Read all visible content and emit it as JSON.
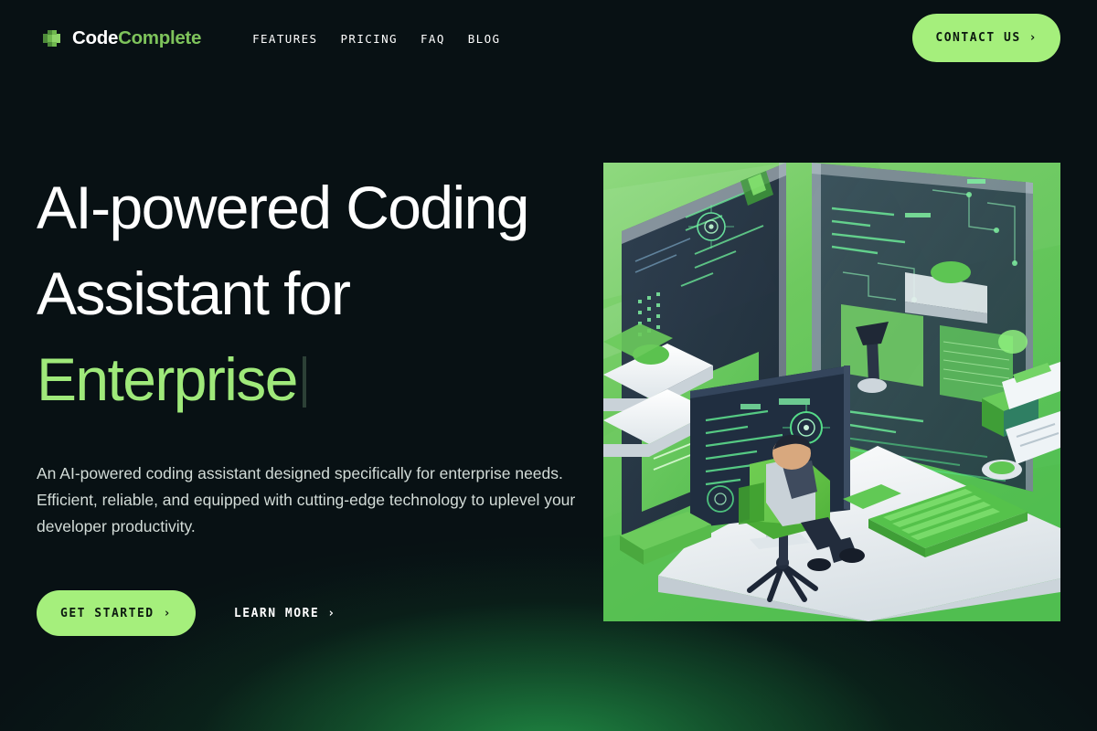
{
  "theme": {
    "background": "#081114",
    "accent_green": "#a5ef7c",
    "logo_green": "#7ec35b",
    "headline_accent": "#9fe97a",
    "text_primary": "#ffffff",
    "text_secondary": "#d3dcd8",
    "glow_green": "#229648"
  },
  "header": {
    "logo": {
      "icon": "codecomplete-blocks-icon",
      "text_primary": "Code",
      "text_accent": "Complete"
    },
    "nav": [
      {
        "label": "FEATURES"
      },
      {
        "label": "PRICING"
      },
      {
        "label": "FAQ"
      },
      {
        "label": "BLOG"
      }
    ],
    "contact_button": {
      "label": "CONTACT US",
      "icon": "chevron-right-icon",
      "glyph": "›"
    }
  },
  "hero": {
    "headline": {
      "line1": "AI-powered Coding",
      "line2": "Assistant for",
      "line3_accent": "Enterprise",
      "caret": true
    },
    "subtitle": "An AI-powered coding assistant designed specifically for enterprise needs. Efficient, reliable, and equipped with cutting-edge technology to uplevel your developer productivity.",
    "primary_cta": {
      "label": "GET STARTED",
      "icon": "chevron-right-icon",
      "glyph": "›"
    },
    "secondary_cta": {
      "label": "LEARN MORE",
      "icon": "chevron-right-icon",
      "glyph": "›"
    },
    "illustration": {
      "name": "isometric-developer-workspace-illustration",
      "description": "Isometric illustration of a developer seated in a green office chair at a white desk facing a dark monitor with green code, surrounded by large translucent dark screens showing green circuit diagrams and code panels, a green keyboard, tablet and notebooks, on a green gradient background."
    }
  }
}
